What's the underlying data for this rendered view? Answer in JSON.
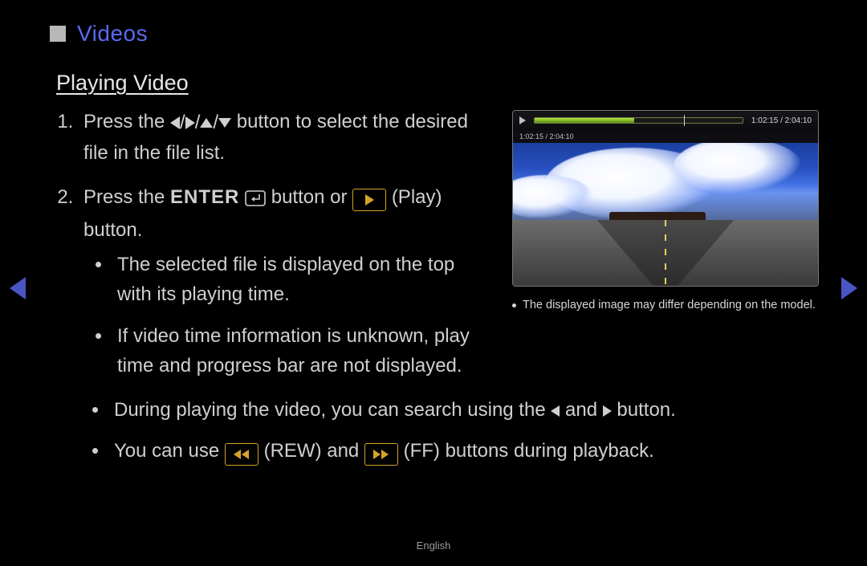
{
  "section": {
    "title": "Videos"
  },
  "subtitle": "Playing Video",
  "steps": {
    "s1_a": "Press the ",
    "s1_b": " button to select the desired file in the file list.",
    "s2_a": "Press the ",
    "s2_enter": "ENTER",
    "s2_b": " button or ",
    "s2_c": " (Play) button."
  },
  "nested_bullets": {
    "b1": "The selected file is displayed on the top with its playing time.",
    "b2": "If video time information is unknown, play time and progress bar are not displayed."
  },
  "wide_bullets": {
    "b3_a": "During playing the video, you can search using the ",
    "b3_mid": " and ",
    "b3_b": " button.",
    "b4_a": "You can use ",
    "b4_rew": " (REW) and ",
    "b4_ff": " (FF) buttons during playback."
  },
  "preview": {
    "time_top": "1:02:15 / 2:04:10",
    "time_sub": "1:02:15 / 2:04:10",
    "caption": "The displayed image may differ depending on the model."
  },
  "footer": "English"
}
